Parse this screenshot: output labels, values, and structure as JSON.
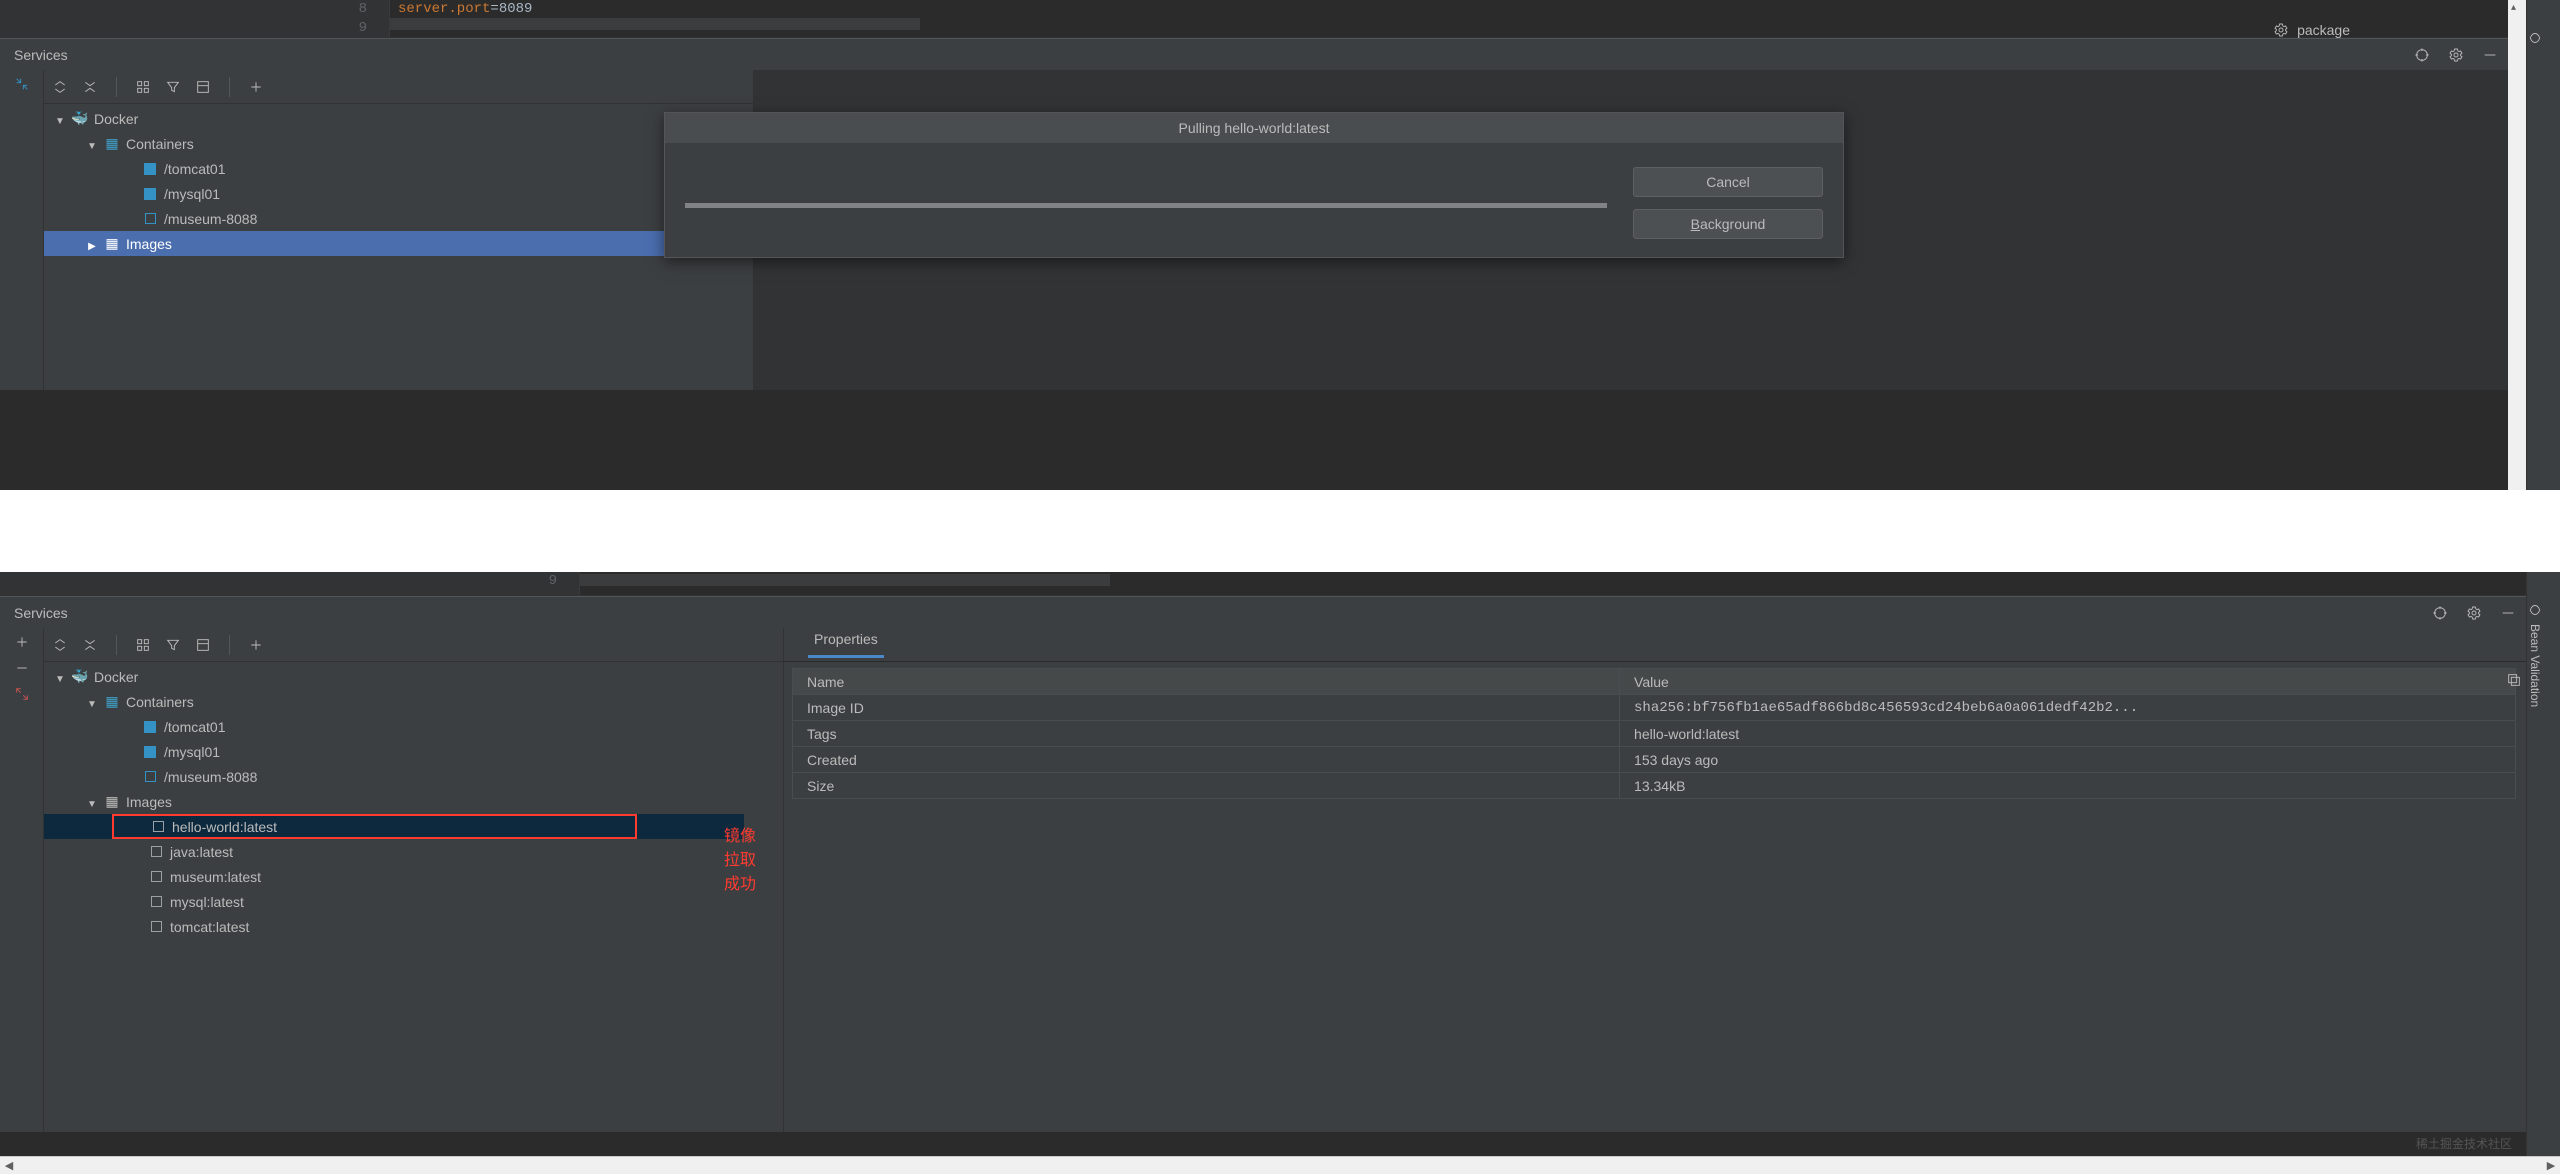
{
  "editor": {
    "line8_num": "8",
    "line9_num": "9",
    "code_key": "server.port",
    "code_eq": "=",
    "code_val": "8089"
  },
  "rightTools": {
    "package": "package"
  },
  "services_label": "Services",
  "sidebar_vertical": "Bean Validation",
  "top": {
    "tree": {
      "docker": "Docker",
      "containers": "Containers",
      "c1": "/tomcat01",
      "c2": "/mysql01",
      "c3": "/museum-8088",
      "images": "Images"
    },
    "dialog": {
      "title": "Pulling hello-world:latest",
      "cancel": "Cancel",
      "background_b": "B",
      "background_rest": "ackground"
    }
  },
  "bottom": {
    "line9_num": "9",
    "tree": {
      "docker": "Docker",
      "containers": "Containers",
      "c1": "/tomcat01",
      "c2": "/mysql01",
      "c3": "/museum-8088",
      "images": "Images",
      "img1": "hello-world:latest",
      "img2": "java:latest",
      "img3": "museum:latest",
      "img4": "mysql:latest",
      "img5": "tomcat:latest"
    },
    "annotation": "镜像拉取成功",
    "props": {
      "tab": "Properties",
      "h_name": "Name",
      "h_value": "Value",
      "rows": [
        {
          "n": "Image ID",
          "v": "sha256:bf756fb1ae65adf866bd8c456593cd24beb6a0a061dedf42b2..."
        },
        {
          "n": "Tags",
          "v": "hello-world:latest"
        },
        {
          "n": "Created",
          "v": "153 days ago"
        },
        {
          "n": "Size",
          "v": "13.34kB"
        }
      ]
    }
  },
  "watermark": "稀土掘金技术社区"
}
